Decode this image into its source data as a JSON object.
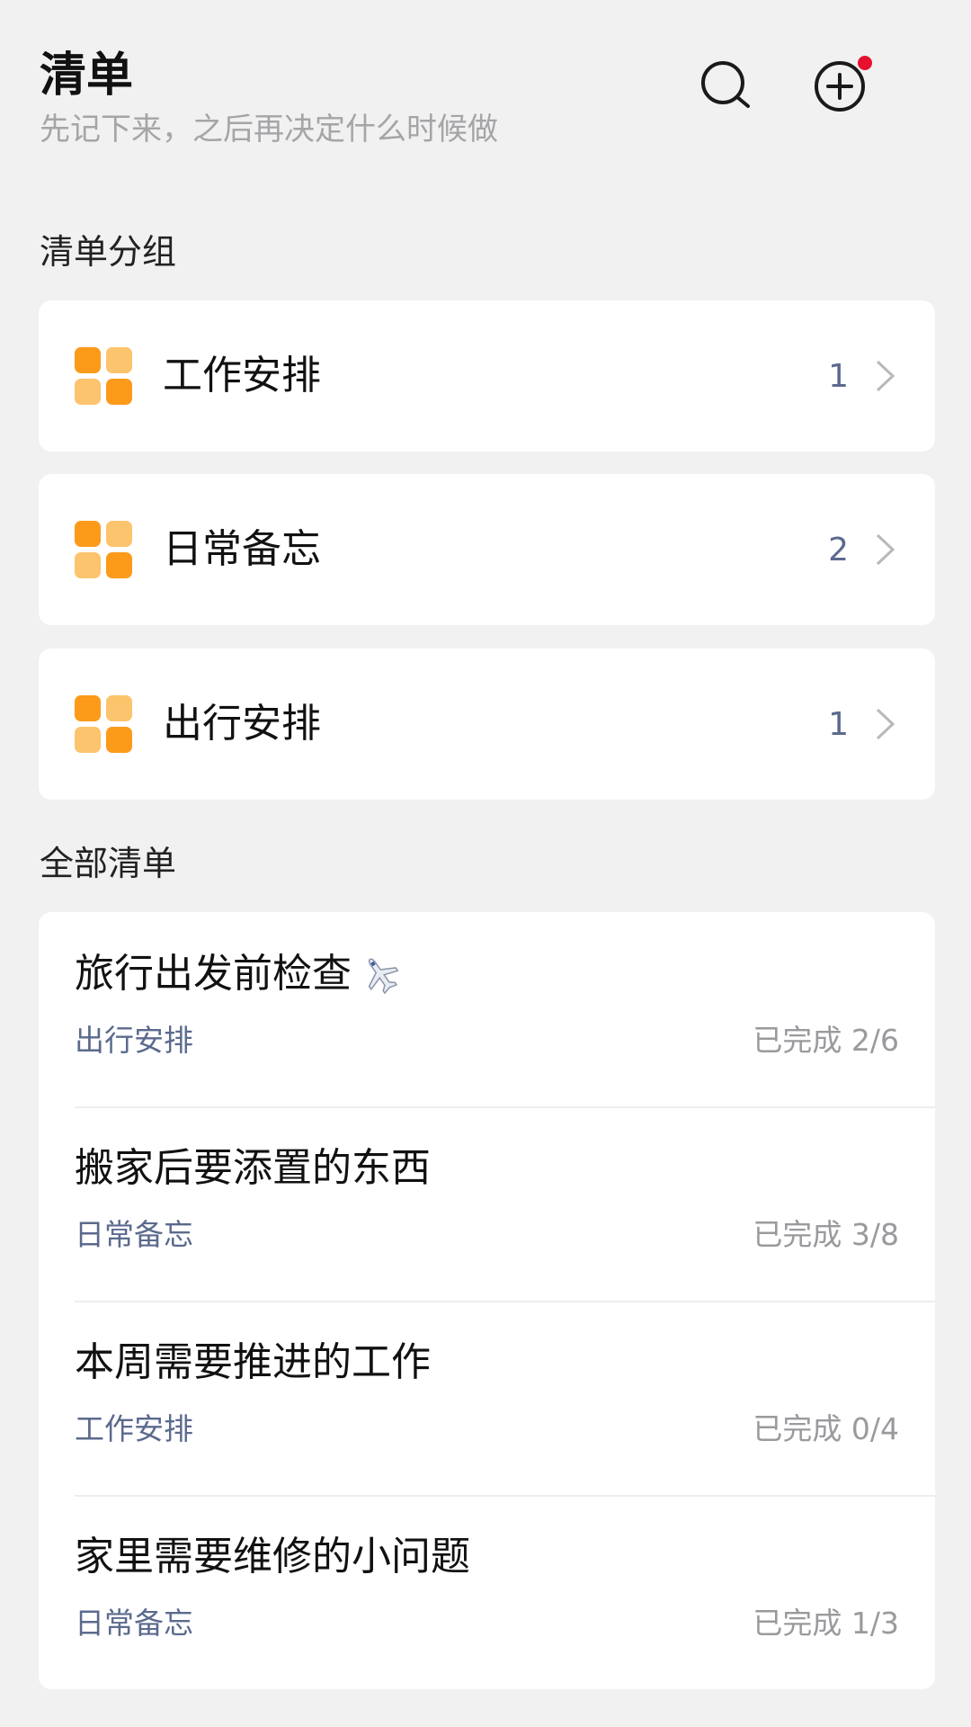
{
  "header": {
    "title": "清单",
    "subtitle": "先记下来，之后再决定什么时候做",
    "search_icon": "search-icon",
    "add_icon": "add-circle-icon",
    "notification_color": "#e8112d"
  },
  "sections": {
    "groups_label": "清单分组",
    "all_label": "全部清单"
  },
  "colors": {
    "accent_orange_dark": "#fc9a1a",
    "accent_orange_light": "#fdc46e",
    "group_text": "#5b6a8d",
    "progress_text": "#9a9a9e"
  },
  "groups": [
    {
      "name": "工作安排",
      "count": "1",
      "icon": "grid-icon"
    },
    {
      "name": "日常备忘",
      "count": "2",
      "icon": "grid-icon"
    },
    {
      "name": "出行安排",
      "count": "1",
      "icon": "grid-icon"
    }
  ],
  "lists": [
    {
      "title": "旅行出发前检查",
      "emoji_icon": "airplane-icon",
      "group": "出行安排",
      "progress": "已完成 2/6"
    },
    {
      "title": "搬家后要添置的东西",
      "group": "日常备忘",
      "progress": "已完成 3/8"
    },
    {
      "title": "本周需要推进的工作",
      "group": "工作安排",
      "progress": "已完成 0/4"
    },
    {
      "title": "家里需要维修的小问题",
      "group": "日常备忘",
      "progress": "已完成 1/3"
    }
  ]
}
